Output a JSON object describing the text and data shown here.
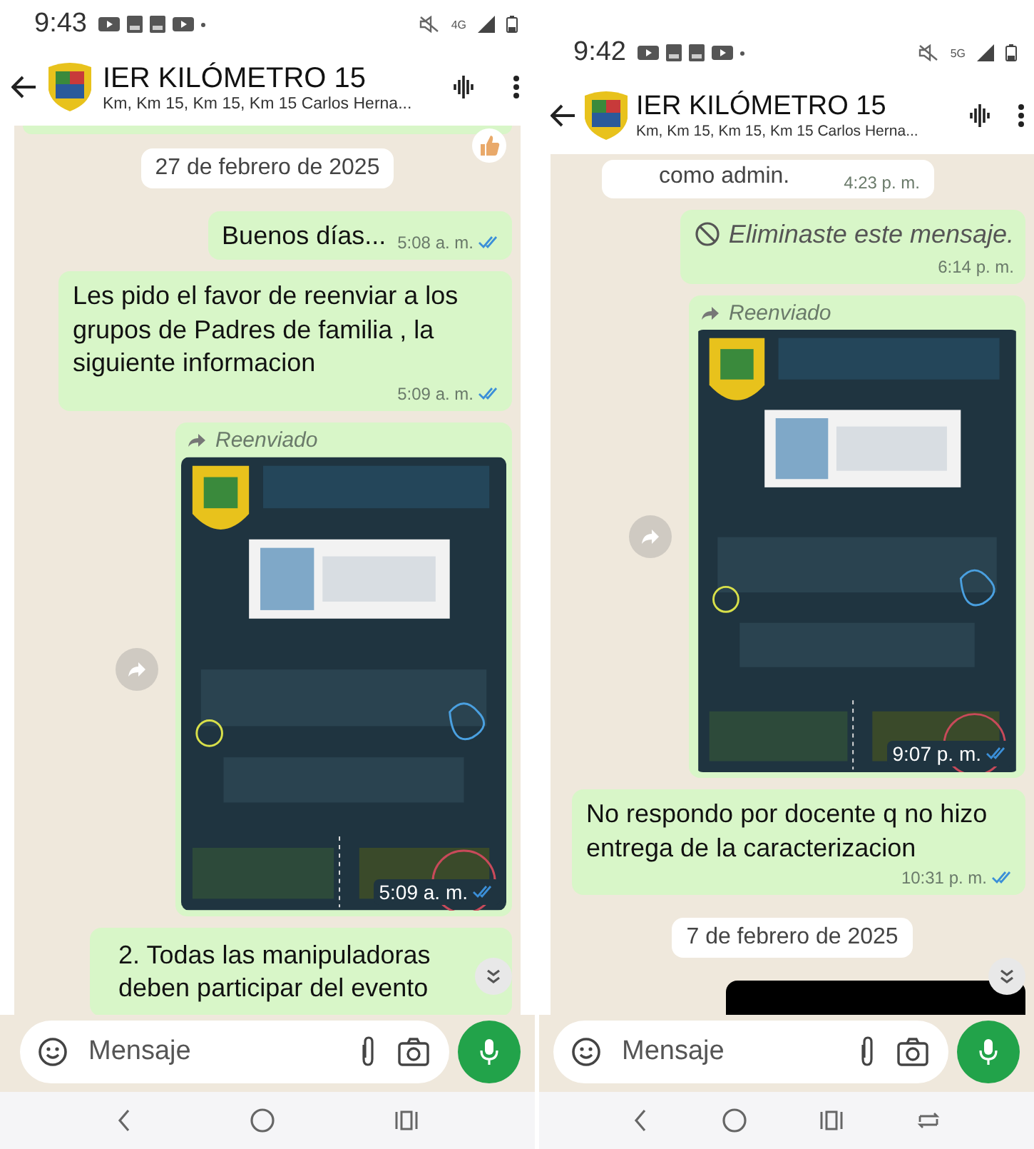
{
  "screens": [
    {
      "status_bar": {
        "time": "9:43",
        "network": "4G"
      },
      "header": {
        "title": "IER KILÓMETRO 15",
        "subtitle": "Km, Km 15, Km 15, Km 15 Carlos Herna..."
      },
      "messages": [
        {
          "kind": "reaction"
        },
        {
          "kind": "date",
          "text": "27 de febrero de 2025"
        },
        {
          "kind": "text",
          "text": "Buenos días...",
          "time": "5:08 a. m.",
          "read": true
        },
        {
          "kind": "text",
          "text": "Les pido el favor de reenviar a los grupos de Padres de familia , la siguiente informacion",
          "time": "5:09 a. m.",
          "read": true
        },
        {
          "forwarded": "Reenviado",
          "time": "5:09 a. m.",
          "read": true
        },
        {
          "kind": "list",
          "text": "2. Todas las manipuladoras deben participar del evento"
        }
      ],
      "composer": {
        "placeholder": "Mensaje"
      }
    },
    {
      "status_bar": {
        "time": "9:42",
        "network": "5G"
      },
      "header": {
        "title": "IER KILÓMETRO 15",
        "subtitle": "Km, Km 15, Km 15, Km 15 Carlos Herna..."
      },
      "messages": [
        {
          "kind": "incoming",
          "text": "como admin.",
          "time": "4:23 p. m."
        },
        {
          "kind": "deleted",
          "text": "Eliminaste este mensaje.",
          "time": "6:14 p. m."
        },
        {
          "forwarded": "Reenviado",
          "time": "9:07 p. m.",
          "read": true
        },
        {
          "kind": "text",
          "text": "No respondo por docente q no hizo entrega de la caracterizacion",
          "time": "10:31 p. m.",
          "read": true
        },
        {
          "kind": "date",
          "text": "7 de febrero de 2025"
        },
        {
          "kind": "media"
        }
      ],
      "composer": {
        "placeholder": "Mensaje"
      }
    }
  ]
}
